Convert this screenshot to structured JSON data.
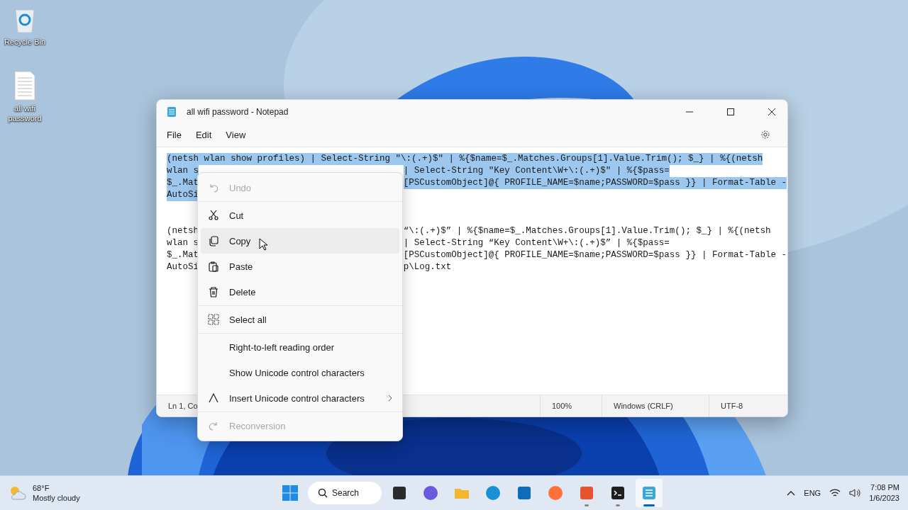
{
  "desktop_icons": [
    {
      "label": "Recycle Bin"
    },
    {
      "label": "all wifi password"
    }
  ],
  "window": {
    "title": "all wifi password - Notepad"
  },
  "menu_bar": [
    "File",
    "Edit",
    "View"
  ],
  "editor": {
    "lines": [
      {
        "kind": "text",
        "left": "(netsh wlan show profiles) | Select-String \"\\:(.+)$\" | %{$name=$_.Matches.Groups[1].Value.Trim(); $_} | %{(netsh",
        "selected": true
      },
      {
        "kind": "text",
        "left": "wlan s",
        "right": "| Select-String \"Key Content\\W+\\:(.+)$\" | %{$pass=",
        "selected": true
      },
      {
        "kind": "text",
        "left": "$_.Mat",
        "right": "[PSCustomObject]@{ PROFILE_NAME=$name;PASSWORD=$pass }} | Format-Table -",
        "selected": true
      },
      {
        "kind": "text",
        "left": "AutoSi",
        "selected": true
      },
      {
        "kind": "blank"
      },
      {
        "kind": "blank"
      },
      {
        "kind": "text",
        "left": "(netsh",
        "right": "“\\:(.+)$” | %{$name=$_.Matches.Groups[1].Value.Trim(); $_} | %{(netsh",
        "selected": false
      },
      {
        "kind": "text",
        "left": "wlan s",
        "right": "| Select-String “Key Content\\W+\\:(.+)$” | %{$pass=",
        "selected": false
      },
      {
        "kind": "text",
        "left": "$_.Mat",
        "right": "[PSCustomObject]@{ PROFILE_NAME=$name;PASSWORD=$pass }} | Format-Table -",
        "selected": false
      },
      {
        "kind": "text",
        "left": "AutoSi",
        "right": "p\\Log.txt",
        "selected": false
      }
    ]
  },
  "status_bar": {
    "position": "Ln 1, Co",
    "zoom": "100%",
    "line_ending": "Windows (CRLF)",
    "encoding": "UTF-8"
  },
  "context_menu": [
    {
      "kind": "item",
      "label": "Undo",
      "disabled": true,
      "selected": false
    },
    {
      "kind": "divider"
    },
    {
      "kind": "item",
      "label": "Cut",
      "disabled": false,
      "selected": false
    },
    {
      "kind": "item",
      "label": "Copy",
      "disabled": false,
      "selected": true
    },
    {
      "kind": "item",
      "label": "Paste",
      "disabled": false,
      "selected": false
    },
    {
      "kind": "item",
      "label": "Delete",
      "disabled": false,
      "selected": false
    },
    {
      "kind": "divider"
    },
    {
      "kind": "item",
      "label": "Select all",
      "disabled": false,
      "selected": false
    },
    {
      "kind": "divider"
    },
    {
      "kind": "item",
      "label": "Right-to-left reading order",
      "disabled": false,
      "selected": false
    },
    {
      "kind": "item",
      "label": "Show Unicode control characters",
      "disabled": false,
      "selected": false
    },
    {
      "kind": "submenu",
      "label": "Insert Unicode control characters",
      "disabled": false,
      "selected": false
    },
    {
      "kind": "divider"
    },
    {
      "kind": "item",
      "label": "Reconversion",
      "disabled": true,
      "selected": false
    }
  ],
  "taskbar": {
    "weather": {
      "temperature": "68°F",
      "condition": "Mostly cloudy"
    },
    "search": "Search",
    "apps": [
      {
        "running": false,
        "selected": false
      },
      {
        "running": false,
        "selected": false
      },
      {
        "running": false,
        "selected": false
      },
      {
        "running": false,
        "selected": false
      },
      {
        "running": false,
        "selected": false
      },
      {
        "running": false,
        "selected": false
      },
      {
        "running": true,
        "selected": false
      },
      {
        "running": true,
        "selected": false
      },
      {
        "running": true,
        "selected": true
      }
    ],
    "language": "ENG",
    "time": "7:08 PM",
    "date": "1/6/2023"
  }
}
